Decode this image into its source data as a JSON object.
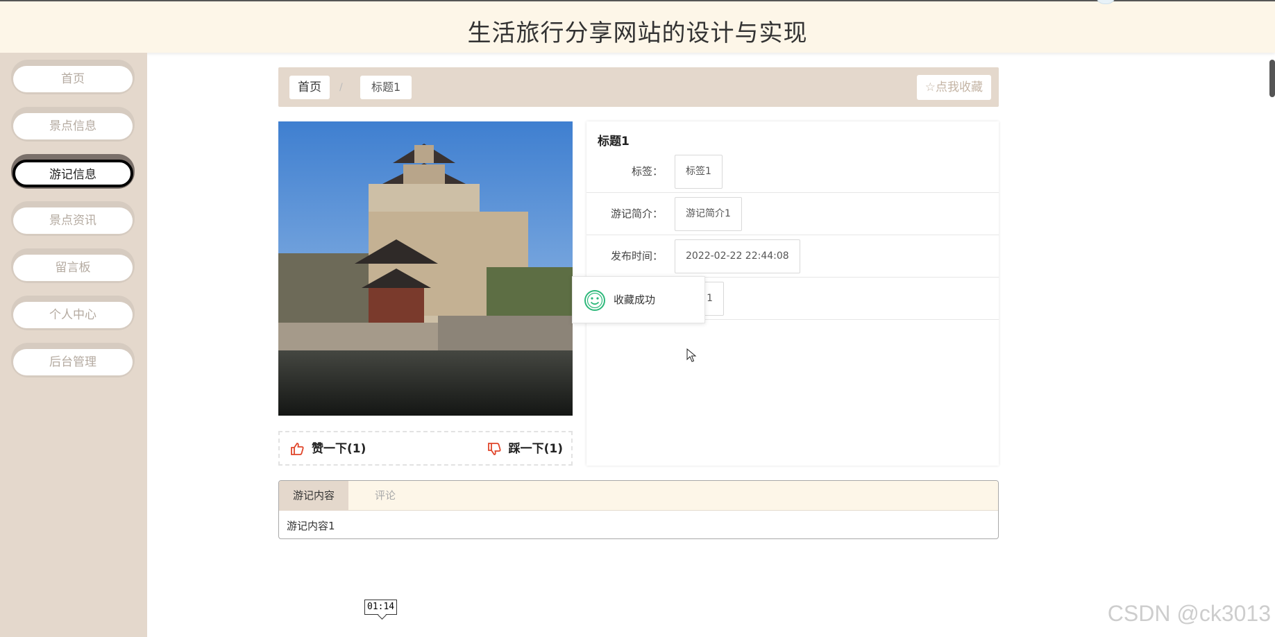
{
  "header": {
    "title": "生活旅行分享网站的设计与实现"
  },
  "sidebar": {
    "items": [
      {
        "label": "首页"
      },
      {
        "label": "景点信息"
      },
      {
        "label": "游记信息"
      },
      {
        "label": "景点资讯"
      },
      {
        "label": "留言板"
      },
      {
        "label": "个人中心"
      },
      {
        "label": "后台管理"
      }
    ],
    "active_index": 2
  },
  "breadcrumb": {
    "home": "首页",
    "separator": "/",
    "current": "标题1"
  },
  "favorite_button": {
    "label": "点我收藏",
    "icon": "star-outline-icon"
  },
  "votes": {
    "like_label": "赞一下(1)",
    "dislike_label": "踩一下(1)"
  },
  "detail": {
    "title": "标题1",
    "rows": [
      {
        "label": "标签：",
        "value": "标签1"
      },
      {
        "label": "游记简介：",
        "value": "游记简介1"
      },
      {
        "label": "发布时间：",
        "value": "2022-02-22 22:44:08"
      },
      {
        "label": "",
        "value": "1"
      }
    ]
  },
  "toast": {
    "text": "收藏成功",
    "icon": "smile-icon"
  },
  "tabs": {
    "items": [
      {
        "label": "游记内容"
      },
      {
        "label": "评论"
      }
    ],
    "content": "游记内容1"
  },
  "overlay": {
    "time": "01:14",
    "watermark": "CSDN @ck3013"
  },
  "colors": {
    "header_bg": "#fdf6e8",
    "sidebar_bg": "#e4d8cc",
    "accent_red": "#e0452a",
    "toast_green": "#2cb87a"
  }
}
